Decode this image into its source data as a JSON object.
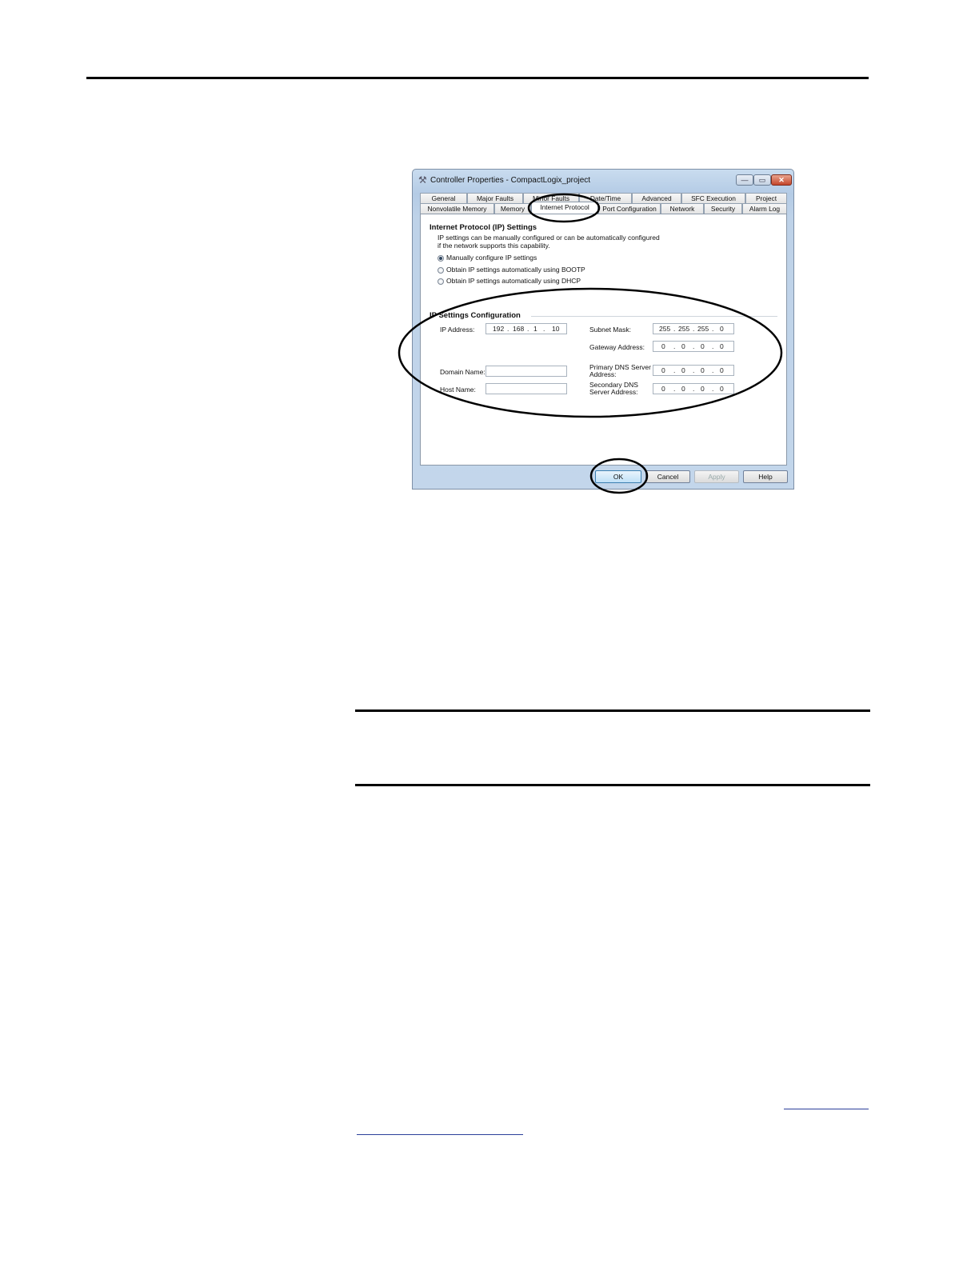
{
  "dialog": {
    "title": "Controller Properties - CompactLogix_project",
    "caption_buttons": {
      "minimize": "—",
      "maximize": "▭",
      "close": "✕"
    },
    "app_icon": "wrench-icon",
    "tabs_row1": [
      "General",
      "Major Faults",
      "Minor Faults",
      "Date/Time",
      "Advanced",
      "SFC Execution",
      "Project"
    ],
    "tabs_row2": [
      "Nonvolatile Memory",
      "Memory",
      "Internet Protocol",
      "Port Configuration",
      "Network",
      "Security",
      "Alarm Log"
    ],
    "active_tab": "Internet Protocol",
    "ip_settings": {
      "heading": "Internet Protocol (IP) Settings",
      "desc1": "IP settings can be manually configured or can be automatically configured",
      "desc2": "if the network supports this capability.",
      "options": [
        {
          "label": "Manually configure IP settings",
          "selected": true
        },
        {
          "label": "Obtain IP settings automatically using BOOTP",
          "selected": false
        },
        {
          "label": "Obtain IP settings automatically using DHCP",
          "selected": false
        }
      ]
    },
    "config": {
      "heading": "IP Settings Configuration",
      "ip_address": {
        "label": "IP Address:",
        "octets": [
          "192",
          "168",
          "1",
          "10"
        ]
      },
      "subnet_mask": {
        "label": "Subnet Mask:",
        "octets": [
          "255",
          "255",
          "255",
          "0"
        ]
      },
      "gateway": {
        "label": "Gateway Address:",
        "octets": [
          "0",
          "0",
          "0",
          "0"
        ]
      },
      "primary_dns": {
        "label_line1": "Primary DNS Server",
        "label_line2": "Address:",
        "octets": [
          "0",
          "0",
          "0",
          "0"
        ]
      },
      "secondary_dns": {
        "label_line1": "Secondary DNS",
        "label_line2": "Server Address:",
        "octets": [
          "0",
          "0",
          "0",
          "0"
        ]
      },
      "domain_name": {
        "label": "Domain Name:",
        "value": ""
      },
      "host_name": {
        "label": "Host Name:",
        "value": ""
      }
    },
    "buttons": {
      "ok": "OK",
      "cancel": "Cancel",
      "apply": "Apply",
      "help": "Help"
    }
  }
}
